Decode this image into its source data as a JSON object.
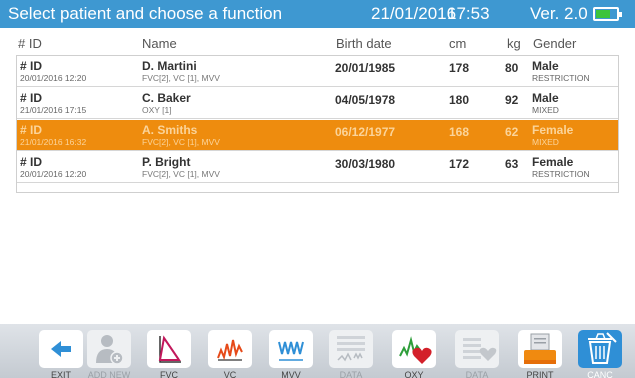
{
  "topbar": {
    "title": "Select patient and choose a function",
    "date": "21/01/2016",
    "time": "17:53",
    "version": "Ver. 2.0",
    "battery_icon": "battery-icon",
    "battery_level": 0.7,
    "colors": {
      "bar": "#3e98d1",
      "battery": "#3cc43c"
    }
  },
  "columns": {
    "id": "# ID",
    "name": "Name",
    "birth_date": "Birth date",
    "cm": "cm",
    "kg": "kg",
    "gender": "Gender"
  },
  "rows": [
    {
      "id": "# ID",
      "timestamp": "20/01/2016   12:20",
      "name": "D. Martini",
      "tests": "FVC[2], VC [1], MVV",
      "birth_date": "20/01/1985",
      "cm": "178",
      "kg": "80",
      "gender": "Male",
      "pattern": "RESTRICTION",
      "selected": false
    },
    {
      "id": "# ID",
      "timestamp": "21/01/2016   17:15",
      "name": "C. Baker",
      "tests": "OXY [1]",
      "birth_date": "04/05/1978",
      "cm": "180",
      "kg": "92",
      "gender": "Male",
      "pattern": "MIXED",
      "selected": false
    },
    {
      "id": "# ID",
      "timestamp": "21/01/2016   16:32",
      "name": "A. Smiths",
      "tests": "FVC[2], VC [1], MVV",
      "birth_date": "06/12/1977",
      "cm": "168",
      "kg": "62",
      "gender": "Female",
      "pattern": "MIXED",
      "selected": true
    },
    {
      "id": "# ID",
      "timestamp": "20/01/2016   12:20",
      "name": "P. Bright",
      "tests": "FVC[2], VC [1], MVV",
      "birth_date": "30/03/1980",
      "cm": "172",
      "kg": "63",
      "gender": "Female",
      "pattern": "RESTRICTION",
      "selected": false
    }
  ],
  "selection_color": "#ee8c0e",
  "toolbar": {
    "buttons": [
      {
        "label": "EXIT",
        "icon": "back-arrow-icon",
        "enabled": true
      },
      {
        "label": "ADD NEW",
        "icon": "add-user-icon",
        "enabled": false
      },
      {
        "label": "FVC",
        "icon": "fvc-loop-icon",
        "enabled": true
      },
      {
        "label": "VC",
        "icon": "vc-curve-icon",
        "enabled": true
      },
      {
        "label": "MVV",
        "icon": "mvv-wave-icon",
        "enabled": true
      },
      {
        "label": "DATA",
        "icon": "spiro-data-icon",
        "enabled": false
      },
      {
        "label": "OXY",
        "icon": "oxy-heart-icon",
        "enabled": true
      },
      {
        "label": "DATA",
        "icon": "oxy-data-icon",
        "enabled": false
      },
      {
        "label": "PRINT",
        "icon": "printer-icon",
        "enabled": true
      },
      {
        "label": "CANC",
        "icon": "trash-icon",
        "enabled": true
      }
    ]
  }
}
